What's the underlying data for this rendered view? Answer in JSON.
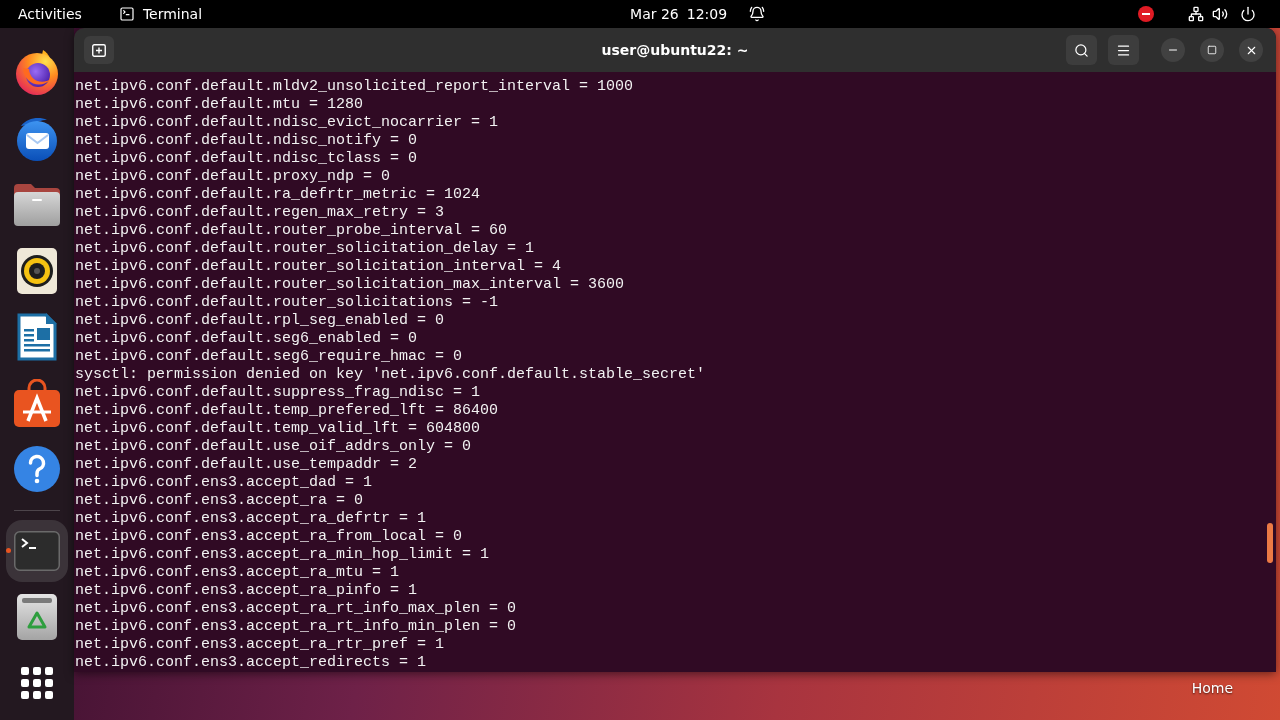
{
  "top_bar": {
    "activities": "Activities",
    "app_menu": "Terminal",
    "date": "Mar 26",
    "time": "12:09"
  },
  "dock": {
    "items": [
      {
        "kind": "browser",
        "running": false,
        "selected": false
      },
      {
        "kind": "mail",
        "running": false,
        "selected": false
      },
      {
        "kind": "files",
        "running": false,
        "selected": false
      },
      {
        "kind": "music",
        "running": false,
        "selected": false
      },
      {
        "kind": "writer",
        "running": false,
        "selected": false
      },
      {
        "kind": "store",
        "running": false,
        "selected": false
      },
      {
        "kind": "help",
        "running": false,
        "selected": false
      },
      {
        "kind": "separator"
      },
      {
        "kind": "terminal",
        "running": true,
        "selected": true
      },
      {
        "kind": "trash",
        "running": false,
        "selected": false
      },
      {
        "kind": "apps",
        "selected": false
      }
    ]
  },
  "terminal": {
    "title": "user@ubuntu22: ~",
    "lines": [
      "net.ipv6.conf.default.mldv2_unsolicited_report_interval = 1000",
      "net.ipv6.conf.default.mtu = 1280",
      "net.ipv6.conf.default.ndisc_evict_nocarrier = 1",
      "net.ipv6.conf.default.ndisc_notify = 0",
      "net.ipv6.conf.default.ndisc_tclass = 0",
      "net.ipv6.conf.default.proxy_ndp = 0",
      "net.ipv6.conf.default.ra_defrtr_metric = 1024",
      "net.ipv6.conf.default.regen_max_retry = 3",
      "net.ipv6.conf.default.router_probe_interval = 60",
      "net.ipv6.conf.default.router_solicitation_delay = 1",
      "net.ipv6.conf.default.router_solicitation_interval = 4",
      "net.ipv6.conf.default.router_solicitation_max_interval = 3600",
      "net.ipv6.conf.default.router_solicitations = -1",
      "net.ipv6.conf.default.rpl_seg_enabled = 0",
      "net.ipv6.conf.default.seg6_enabled = 0",
      "net.ipv6.conf.default.seg6_require_hmac = 0",
      "sysctl: permission denied on key 'net.ipv6.conf.default.stable_secret'",
      "net.ipv6.conf.default.suppress_frag_ndisc = 1",
      "net.ipv6.conf.default.temp_prefered_lft = 86400",
      "net.ipv6.conf.default.temp_valid_lft = 604800",
      "net.ipv6.conf.default.use_oif_addrs_only = 0",
      "net.ipv6.conf.default.use_tempaddr = 2",
      "net.ipv6.conf.ens3.accept_dad = 1",
      "net.ipv6.conf.ens3.accept_ra = 0",
      "net.ipv6.conf.ens3.accept_ra_defrtr = 1",
      "net.ipv6.conf.ens3.accept_ra_from_local = 0",
      "net.ipv6.conf.ens3.accept_ra_min_hop_limit = 1",
      "net.ipv6.conf.ens3.accept_ra_mtu = 1",
      "net.ipv6.conf.ens3.accept_ra_pinfo = 1",
      "net.ipv6.conf.ens3.accept_ra_rt_info_max_plen = 0",
      "net.ipv6.conf.ens3.accept_ra_rt_info_min_plen = 0",
      "net.ipv6.conf.ens3.accept_ra_rtr_pref = 1",
      "net.ipv6.conf.ens3.accept_redirects = 1"
    ]
  },
  "desktop": {
    "icons": [
      {
        "label": "Home"
      }
    ]
  }
}
